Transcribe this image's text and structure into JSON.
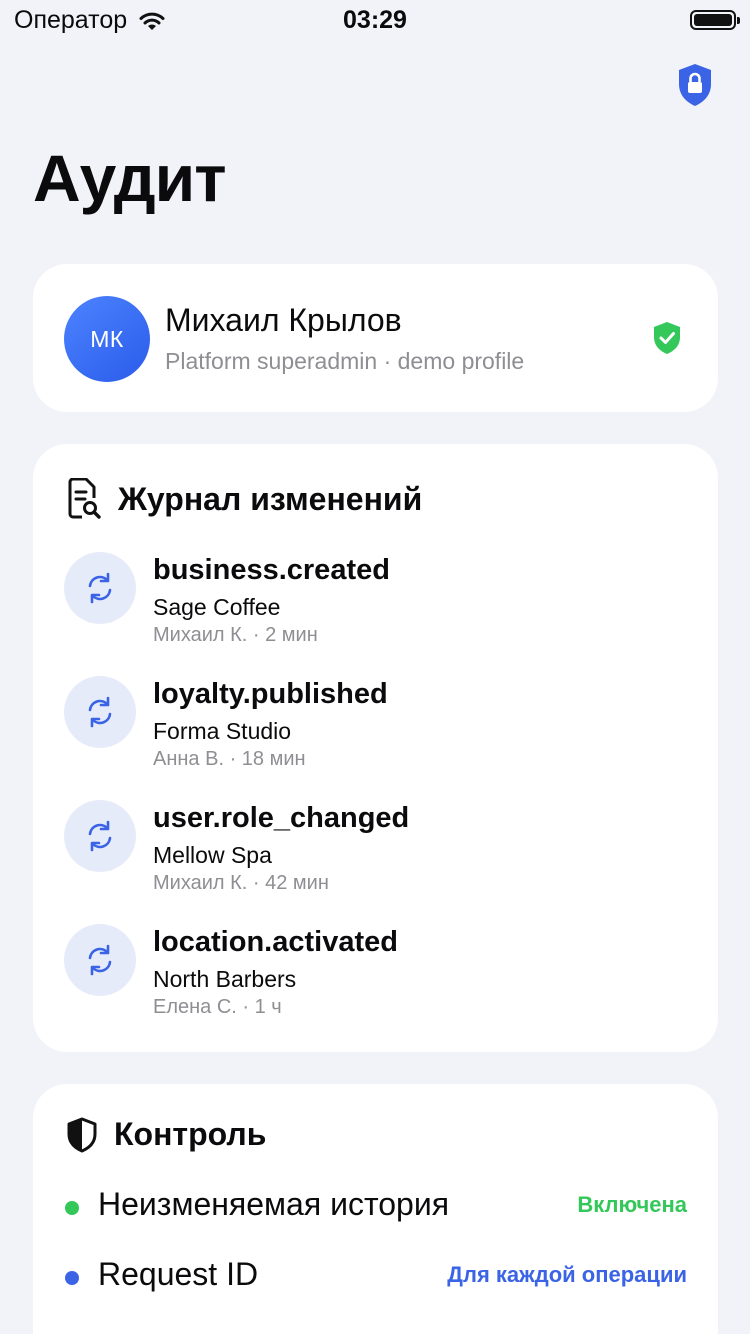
{
  "status_bar": {
    "carrier": "Оператор",
    "time": "03:29"
  },
  "page": {
    "title": "Аудит"
  },
  "profile": {
    "initials": "МК",
    "name": "Михаил Крылов",
    "subtitle": "Platform superadmin · demo profile"
  },
  "log": {
    "title": "Журнал изменений",
    "items": [
      {
        "event": "business.created",
        "entity": "Sage Coffee",
        "meta": "Михаил К. · 2 мин"
      },
      {
        "event": "loyalty.published",
        "entity": "Forma Studio",
        "meta": "Анна В. · 18 мин"
      },
      {
        "event": "user.role_changed",
        "entity": "Mellow Spa",
        "meta": "Михаил К. · 42 мин"
      },
      {
        "event": "location.activated",
        "entity": "North Barbers",
        "meta": "Елена С. · 1 ч"
      }
    ]
  },
  "control": {
    "title": "Контроль",
    "rows": [
      {
        "label": "Неизменяемая история",
        "value": "Включена",
        "color": "#34c759"
      },
      {
        "label": "Request ID",
        "value": "Для каждой операции",
        "color": "#3a63e6"
      }
    ]
  },
  "colors": {
    "accent": "#3a63e6",
    "success": "#34c759",
    "background": "#f2f3f8"
  },
  "icons": {
    "top": "lock-shield-icon",
    "verified": "verified-shield-icon",
    "log": "document-search-icon",
    "item": "sync-icon",
    "control": "shield-icon"
  }
}
